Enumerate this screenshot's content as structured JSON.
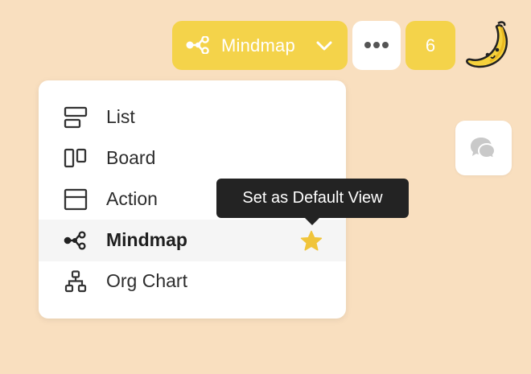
{
  "header": {
    "view_switcher": {
      "label": "Mindmap",
      "icon": "mindmap-icon",
      "chevron_icon": "chevron-down-icon"
    },
    "more_button": {
      "icon": "more-horizontal-icon"
    },
    "count_badge": "6",
    "mascot": {
      "icon": "banana-icon"
    }
  },
  "comment_button": {
    "icon": "comments-icon"
  },
  "view_menu": {
    "items": [
      {
        "label": "List",
        "icon": "list-view-icon"
      },
      {
        "label": "Board",
        "icon": "board-view-icon"
      },
      {
        "label": "Action",
        "icon": "action-view-icon"
      },
      {
        "label": "Mindmap",
        "icon": "mindmap-icon",
        "selected": true,
        "default_star_icon": "star-icon"
      },
      {
        "label": "Org Chart",
        "icon": "org-chart-icon"
      }
    ]
  },
  "tooltip": {
    "text": "Set as Default View"
  },
  "colors": {
    "background": "#f9dfbf",
    "accent": "#f4d34a",
    "star": "#f0c43a",
    "tooltip_bg": "#232323"
  }
}
